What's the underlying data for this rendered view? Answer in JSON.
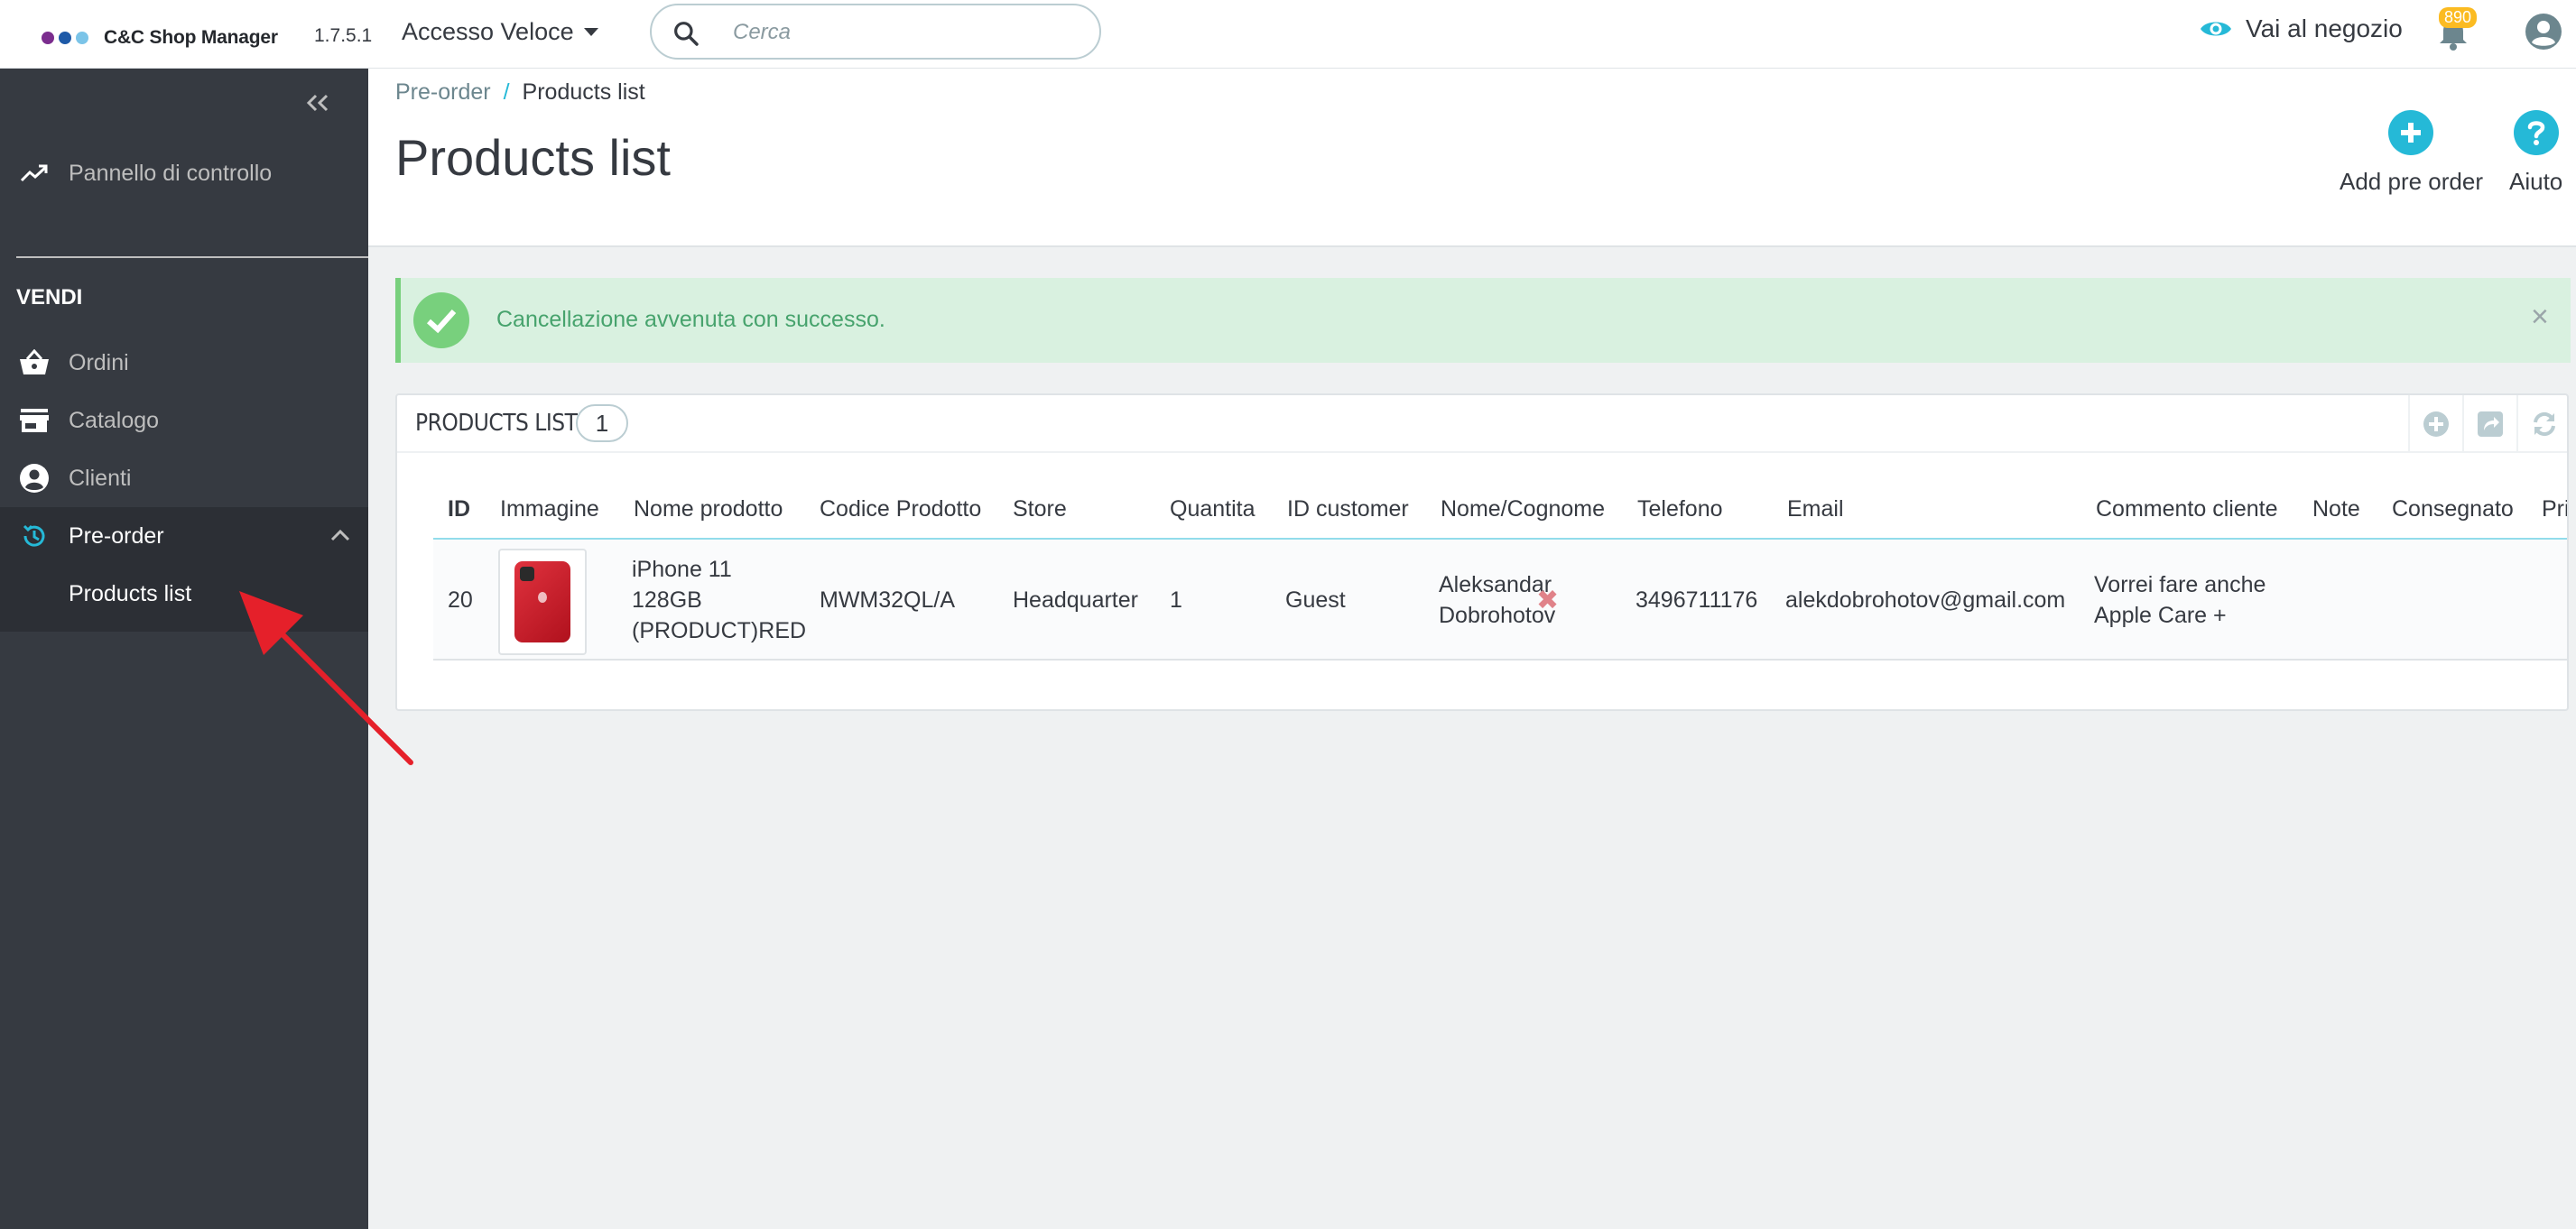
{
  "header": {
    "brand": "C&C Shop Manager",
    "logo_colors": [
      "#7b2d8e",
      "#1e5aa8",
      "#7bc4e8"
    ],
    "version": "1.7.5.1",
    "quick_access": "Accesso Veloce",
    "search_placeholder": "Cerca",
    "view_shop": "Vai al negozio",
    "notifications_count": "890"
  },
  "sidebar": {
    "dashboard": "Pannello di controllo",
    "section": "VENDI",
    "items": [
      {
        "label": "Ordini",
        "icon": "basket-icon"
      },
      {
        "label": "Catalogo",
        "icon": "store-icon"
      },
      {
        "label": "Clienti",
        "icon": "account-circle-icon"
      },
      {
        "label": "Pre-order",
        "icon": "history-icon"
      }
    ],
    "subitem": "Products list"
  },
  "breadcrumb": {
    "parent": "Pre-order",
    "separator": "/",
    "current": "Products list"
  },
  "page_title": "Products list",
  "toolbar": {
    "add_label": "Add pre order",
    "help_label": "Aiuto"
  },
  "alert": {
    "message": "Cancellazione avvenuta con successo.",
    "close": "×"
  },
  "panel": {
    "title": "PRODUCTS LIST",
    "count": "1"
  },
  "table": {
    "columns": [
      "ID",
      "Immagine",
      "Nome prodotto",
      "Codice Prodotto",
      "Store",
      "Quantita",
      "ID customer",
      "Nome/Cognome",
      "Telefono",
      "Email",
      "Commento cliente",
      "Note",
      "Consegnato",
      "Prir"
    ],
    "rows": [
      {
        "id": "20",
        "name_lines": [
          "iPhone 11",
          "128GB",
          "(PRODUCT)RED"
        ],
        "code": "MWM32QL/A",
        "store": "Headquarter",
        "quantity": "1",
        "customer_id": "Guest",
        "name_surname_lines": [
          "Aleksandar",
          "Dobrohotov"
        ],
        "phone": "3496711176",
        "email": "alekdobrohotov@gmail.com",
        "comment_lines": [
          "Vorrei fare anche",
          "Apple Care +"
        ],
        "note": "",
        "delivered": "✖"
      }
    ]
  },
  "colors": {
    "accent": "#25b9d7",
    "sidebar_bg": "#363a41",
    "success_bg": "#d9f1e0",
    "success_text": "#47a36d",
    "annotation_arrow": "#e5202a"
  }
}
